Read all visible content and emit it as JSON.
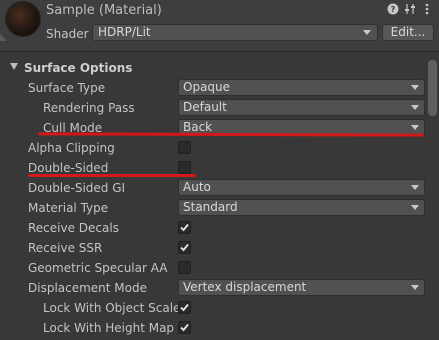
{
  "header": {
    "title": "Sample (Material)",
    "icons": [
      "help-icon",
      "sliders-icon",
      "more-icon"
    ],
    "shader_label": "Shader",
    "shader_value": "HDRP/Lit",
    "edit_label": "Edit..."
  },
  "section": {
    "label": "Surface Options"
  },
  "rows": [
    {
      "label": "Surface Type",
      "control": "dropdown",
      "value": "Opaque"
    },
    {
      "label": "Rendering Pass",
      "control": "dropdown",
      "value": "Default"
    },
    {
      "label": "Cull Mode",
      "control": "dropdown",
      "value": "Back"
    },
    {
      "label": "Alpha Clipping",
      "control": "checkbox",
      "checked": false
    },
    {
      "label": "Double-Sided",
      "control": "checkbox",
      "checked": false
    },
    {
      "label": "Double-Sided GI",
      "control": "dropdown",
      "value": "Auto"
    },
    {
      "label": "Material Type",
      "control": "dropdown",
      "value": "Standard"
    },
    {
      "label": "Receive Decals",
      "control": "checkbox",
      "checked": true
    },
    {
      "label": "Receive SSR",
      "control": "checkbox",
      "checked": true
    },
    {
      "label": "Geometric Specular AA",
      "control": "checkbox",
      "checked": false
    },
    {
      "label": "Displacement Mode",
      "control": "dropdown",
      "value": "Vertex displacement"
    },
    {
      "label": "Lock With Object Scale",
      "control": "checkbox",
      "checked": true
    },
    {
      "label": "Lock With Height Map T",
      "control": "checkbox",
      "checked": true
    }
  ],
  "annotation_color": "#d21818"
}
